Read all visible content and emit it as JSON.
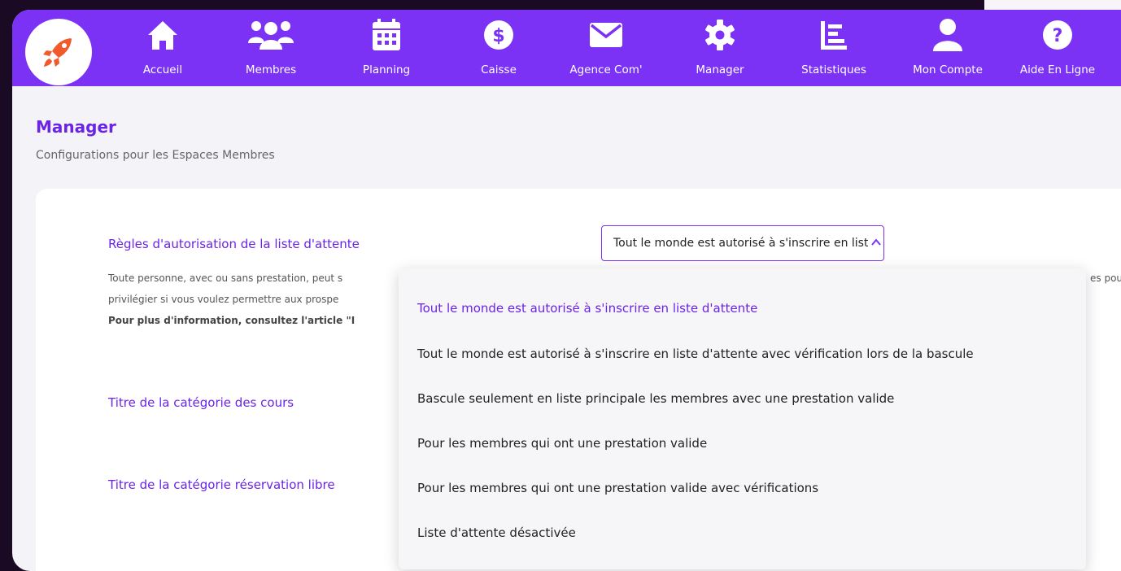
{
  "nav": {
    "items": [
      {
        "label": "Accueil",
        "icon": "home-icon"
      },
      {
        "label": "Membres",
        "icon": "users-icon"
      },
      {
        "label": "Planning",
        "icon": "calendar-icon"
      },
      {
        "label": "Caisse",
        "icon": "dollar-icon"
      },
      {
        "label": "Agence Com'",
        "icon": "envelope-icon"
      },
      {
        "label": "Manager",
        "icon": "gear-icon"
      },
      {
        "label": "Statistiques",
        "icon": "chart-icon"
      },
      {
        "label": "Mon Compte",
        "icon": "user-icon"
      },
      {
        "label": "Aide En Ligne",
        "icon": "help-icon"
      }
    ]
  },
  "page": {
    "title": "Manager",
    "subtitle": "Configurations pour les Espaces Membres"
  },
  "settings": {
    "waitlist": {
      "title": "Règles d'autorisation de la liste d'attente",
      "desc_line1": "Toute personne, avec ou sans prestation, peut s",
      "desc_line2": "privilégier si vous voulez permettre aux prospe",
      "desc_line3": "Pour plus d'information, consultez l'article \"I",
      "desc_tail": "es pou",
      "select_value": "Tout le monde est autorisé à s'inscrire en liste d'attente"
    },
    "course_category_title": "Titre de la catégorie des cours",
    "free_booking_category_title": "Titre de la catégorie réservation libre"
  },
  "dropdown": {
    "options": [
      "Tout le monde est autorisé à s'inscrire en liste d'attente",
      "Tout le monde est autorisé à s'inscrire en liste d'attente avec vérification lors de la bascule",
      "Bascule seulement en liste principale les membres avec une prestation valide",
      "Pour les membres qui ont une prestation valide",
      "Pour les membres qui ont une prestation valide avec vérifications",
      "Liste d'attente désactivée"
    ],
    "selected_index": 0
  },
  "colors": {
    "brand": "#7b32f5",
    "accent_text": "#6b24e6",
    "logo": "#f15a2b"
  }
}
